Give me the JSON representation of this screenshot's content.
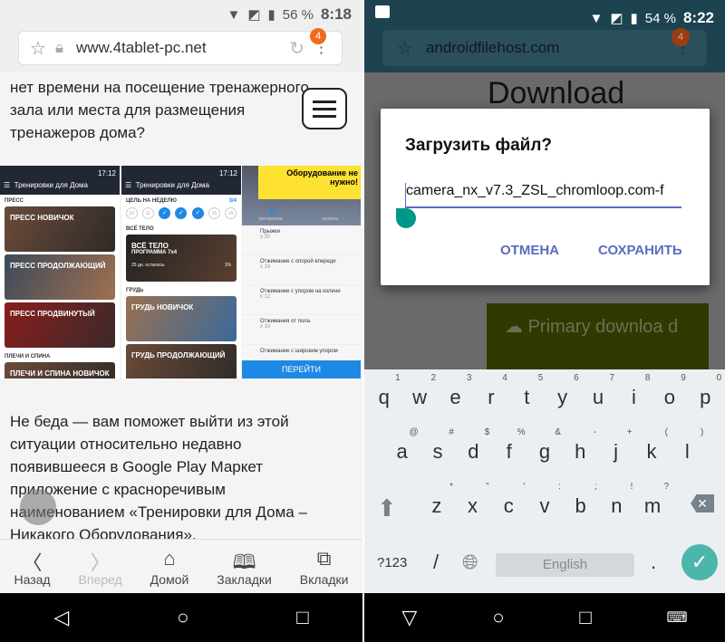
{
  "left": {
    "status": {
      "battery": "56 %",
      "time": "8:18"
    },
    "address": {
      "url": "www.4tablet-pc.net",
      "tab_badge": "4"
    },
    "para1": "нет времени на посещение тренажерного зала или места для размещения тренажеров дома?",
    "shot": {
      "time": "17:12",
      "app_title": "Тренировки для Дома",
      "s1": {
        "section1": "ПРЕСС",
        "cards": [
          "ПРЕСС НОВИЧОК",
          "ПРЕСС ПРОДОЛЖАЮЩИЙ",
          "ПРЕСС ПРОДВИНУТЫЙ"
        ],
        "section2": "ПЛЕЧИ И СПИНА",
        "card4": "ПЛЕЧИ И СПИНА НОВИЧОК"
      },
      "s2": {
        "goal": "ЦЕЛЬ НА НЕДЕЛЮ",
        "goal_count": "3/4",
        "days": [
          "10",
          "11",
          "✓",
          "✓",
          "✓",
          "15",
          "16"
        ],
        "section1": "ВСЁ ТЕЛО",
        "card1": "ВСЁ ТЕЛО",
        "card1_sub": "ПРОГРАММА 7x4",
        "card1_left": "25 дн. осталось",
        "card1_pct": "1%",
        "section2": "ГРУДЬ",
        "card2": "ГРУДЬ НОВИЧОК",
        "card3": "ГРУДЬ ПРОДОЛЖАЮЩИЙ"
      },
      "s3": {
        "banner": "Оборудование не нужно!",
        "count": "11",
        "count_label": "тренировки",
        "level_label": "уровень",
        "exercises": [
          {
            "name": "Прыжки",
            "reps": "x 30"
          },
          {
            "name": "Отжимание с опорой впереди",
            "reps": "x 16"
          },
          {
            "name": "Отжимание с упором на колени",
            "reps": "x 12"
          },
          {
            "name": "Отжимания от пола",
            "reps": "x 10"
          },
          {
            "name": "Отжимание с широким упором",
            "reps": ""
          }
        ],
        "go": "ПЕРЕЙТИ"
      }
    },
    "para2": "Не беда — вам поможет выйти из этой ситуации относительно недавно появившееся в Google Play Маркет приложение с красноречивым наименованием «Тренировки для Дома – Никакого Оборудования».",
    "toolbar": [
      {
        "icon": "chevron-left",
        "label": "Назад"
      },
      {
        "icon": "chevron-right",
        "label": "Вперед"
      },
      {
        "icon": "home",
        "label": "Домой"
      },
      {
        "icon": "book",
        "label": "Закладки"
      },
      {
        "icon": "tabs",
        "label": "Вкладки"
      }
    ]
  },
  "right": {
    "status": {
      "battery": "54 %",
      "time": "8:22"
    },
    "address": {
      "url": "androidfilehost.com",
      "tab_badge": "4"
    },
    "page_title": "Download",
    "primary": "Primary downloa d",
    "dialog": {
      "title": "Загрузить файл?",
      "filename": "camera_nx_v7.3_ZSL_chromloop.com-f",
      "cancel": "ОТМЕНА",
      "save": "СОХРАНИТЬ"
    },
    "keyboard": {
      "row1": [
        [
          "q",
          "1"
        ],
        [
          "w",
          "2"
        ],
        [
          "e",
          "3"
        ],
        [
          "r",
          "4"
        ],
        [
          "t",
          "5"
        ],
        [
          "y",
          "6"
        ],
        [
          "u",
          "7"
        ],
        [
          "i",
          "8"
        ],
        [
          "o",
          "9"
        ],
        [
          "p",
          "0"
        ]
      ],
      "row2": [
        [
          "a",
          "@"
        ],
        [
          "s",
          "#"
        ],
        [
          "d",
          "$"
        ],
        [
          "f",
          "%"
        ],
        [
          "g",
          "&"
        ],
        [
          "h",
          "-"
        ],
        [
          "j",
          "+"
        ],
        [
          "k",
          "("
        ],
        [
          "l",
          ")"
        ]
      ],
      "row3": [
        [
          "z",
          "*"
        ],
        [
          "x",
          "\""
        ],
        [
          "c",
          "'"
        ],
        [
          "v",
          ":"
        ],
        [
          "b",
          ";"
        ],
        [
          "n",
          "!"
        ],
        [
          "m",
          "?"
        ]
      ],
      "symbols": "?123",
      "slash": "/",
      "space": "English",
      "period": "."
    }
  },
  "colors": {
    "accent": "#5c6bc0",
    "teal": "#009688",
    "badge": "#f26b1d",
    "go_button": "#1e88e5",
    "banner": "#fde232"
  }
}
